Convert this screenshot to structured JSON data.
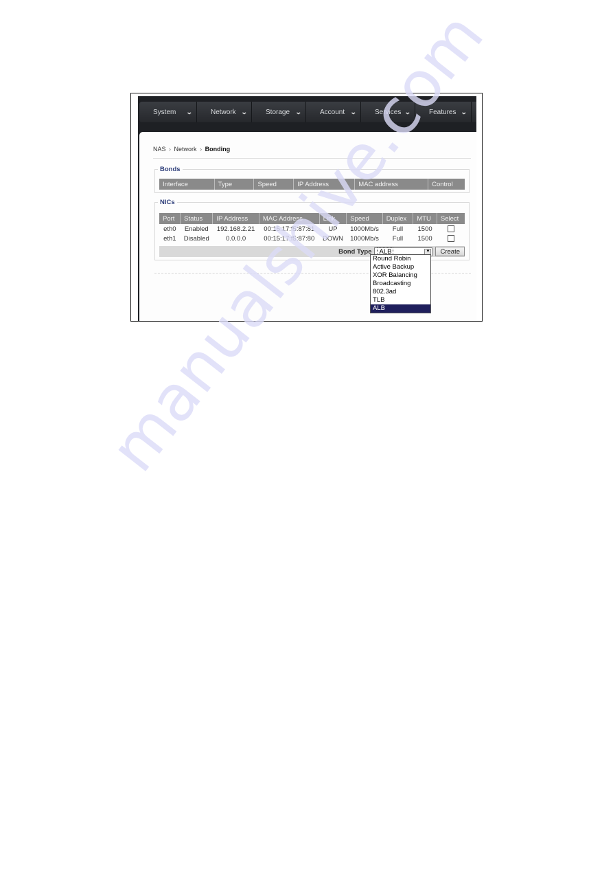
{
  "navbar": {
    "items": [
      {
        "label": "System",
        "icon": "chevron-down-icon"
      },
      {
        "label": "Network",
        "icon": "chevron-down-icon"
      },
      {
        "label": "Storage",
        "icon": "chevron-down-icon"
      },
      {
        "label": "Account",
        "icon": "chevron-down-icon"
      },
      {
        "label": "Services",
        "icon": "chevron-down-icon"
      },
      {
        "label": "Features",
        "icon": "chevron-down-icon"
      }
    ]
  },
  "breadcrumb": {
    "items": [
      "NAS",
      "Network",
      "Bonding"
    ],
    "separator": "›"
  },
  "bonds": {
    "legend": "Bonds",
    "columns": [
      "Interface",
      "Type",
      "Speed",
      "IP Address",
      "MAC address",
      "Control"
    ]
  },
  "nics": {
    "legend": "NICs",
    "columns": [
      "Port",
      "Status",
      "IP Address",
      "MAC Address",
      "Link",
      "Speed",
      "Duplex",
      "MTU",
      "Select"
    ],
    "rows": [
      {
        "port": "eth0",
        "status": "Enabled",
        "ip": "192.168.2.21",
        "mac": "00:15:17:f5:87:81",
        "link": "UP",
        "speed": "1000Mb/s",
        "duplex": "Full",
        "mtu": "1500",
        "selected": false
      },
      {
        "port": "eth1",
        "status": "Disabled",
        "ip": "0.0.0.0",
        "mac": "00:15:17:f5:87:80",
        "link": "DOWN",
        "speed": "1000Mb/s",
        "duplex": "Full",
        "mtu": "1500",
        "selected": false
      }
    ],
    "bond_type_label": "Bond Type",
    "bond_type_value": "ALB",
    "create_label": "Create",
    "bond_type_options": [
      "Round Robin",
      "Active Backup",
      "XOR Balancing",
      "Broadcasting",
      "802.3ad",
      "TLB",
      "ALB"
    ],
    "highlighted_option": "ALB"
  },
  "watermark": "manualshive.com",
  "colors": {
    "navbar": "#2f3236",
    "legend": "#2e3e7a",
    "table_header": "#8a8a8a",
    "dropdown_highlight": "#1f1f5c"
  }
}
